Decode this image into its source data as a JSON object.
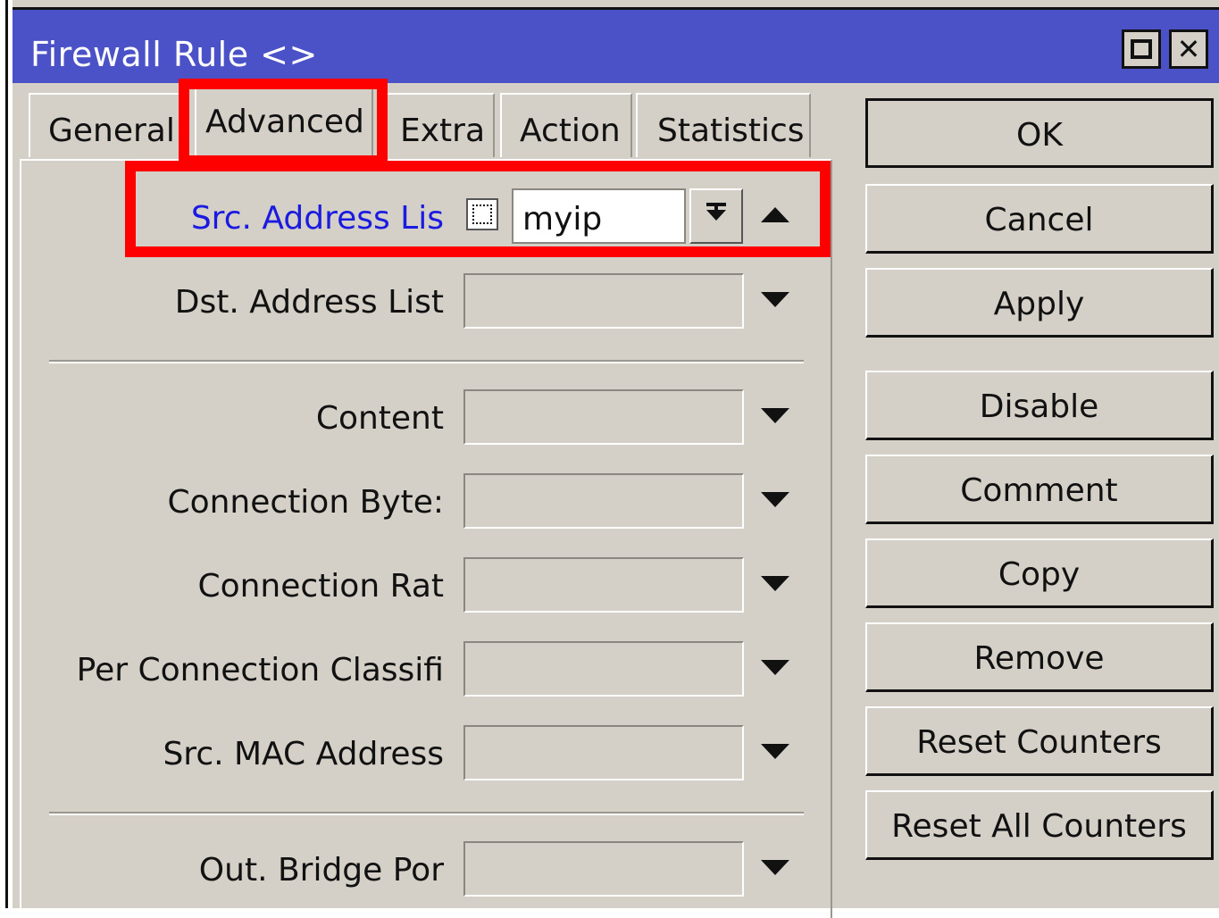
{
  "window": {
    "title": "Firewall Rule <>"
  },
  "tabs": [
    "General",
    "Advanced",
    "Extra",
    "Action",
    "Statistics"
  ],
  "fields": {
    "src_address_list": {
      "label": "Src. Address Lis",
      "value": "myip"
    },
    "dst_address_list": {
      "label": "Dst. Address List",
      "value": ""
    },
    "content": {
      "label": "Content",
      "value": ""
    },
    "connection_bytes": {
      "label": "Connection Byte:",
      "value": ""
    },
    "connection_rate": {
      "label": "Connection Rat",
      "value": ""
    },
    "per_connection_classifier": {
      "label": "Per Connection Classifi",
      "value": ""
    },
    "src_mac_address": {
      "label": "Src. MAC Address",
      "value": ""
    },
    "out_bridge_port": {
      "label": "Out. Bridge Por",
      "value": ""
    }
  },
  "buttons": {
    "ok": "OK",
    "cancel": "Cancel",
    "apply": "Apply",
    "disable": "Disable",
    "comment": "Comment",
    "copy": "Copy",
    "remove": "Remove",
    "reset_counters": "Reset Counters",
    "reset_all_counters": "Reset All Counters"
  },
  "colors": {
    "titlebar": "#4b52c8",
    "highlight": "#ff0000",
    "active_label": "#1a1ae0",
    "background": "#d4d0c8"
  },
  "icons": [
    "maximize-icon",
    "close-icon",
    "dropdown-arrow-icon",
    "collapse-arrow-icon",
    "invert-checkbox-icon"
  ]
}
